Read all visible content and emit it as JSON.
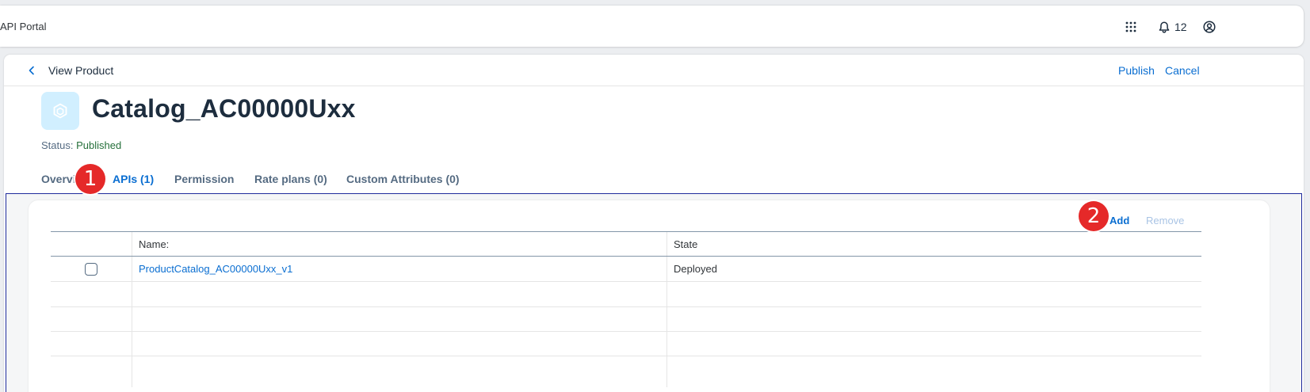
{
  "shell": {
    "title": "API Portal",
    "notification_count": "12",
    "icons": {
      "apps": "grid-icon",
      "notifications": "bell-icon",
      "profile": "user-icon"
    }
  },
  "page": {
    "heading": "View Product",
    "actions": {
      "publish": "Publish",
      "cancel": "Cancel"
    }
  },
  "object": {
    "title": "Catalog_AC00000Uxx",
    "status_label": "Status:",
    "status_value": "Published"
  },
  "tabs": [
    {
      "label": "Overview"
    },
    {
      "label": "APIs (1)"
    },
    {
      "label": "Permission"
    },
    {
      "label": "Rate plans (0)"
    },
    {
      "label": "Custom Attributes (0)"
    }
  ],
  "active_tab": "APIs (1)",
  "toolbar": {
    "add": "Add",
    "remove": "Remove"
  },
  "table": {
    "columns": [
      "Name:",
      "State"
    ],
    "rows": [
      {
        "name": "ProductCatalog_AC00000Uxx_v1",
        "state": "Deployed"
      }
    ]
  },
  "callouts": [
    "1",
    "2"
  ],
  "colors": {
    "accent": "#0a6ed1",
    "status_positive": "#256f3a",
    "callout": "#e52929"
  }
}
